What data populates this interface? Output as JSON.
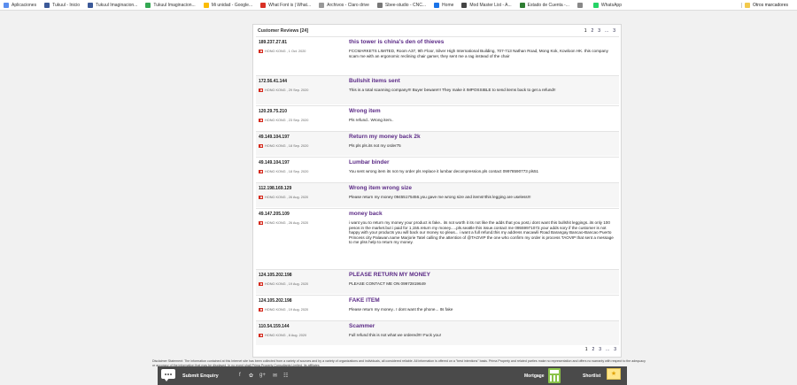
{
  "bookmarks": [
    {
      "label": "Aplicaciones",
      "color": "#5a8dee",
      "icon": "apps-grid-icon"
    },
    {
      "label": "Tukuul - Inicio",
      "color": "#3b5998",
      "icon": "facebook-icon"
    },
    {
      "label": "Tukuul Imaginacion...",
      "color": "#3b5998",
      "icon": "facebook-icon"
    },
    {
      "label": "Tukuul Imaginacion...",
      "color": "#34a853",
      "icon": "maps-pin-icon"
    },
    {
      "label": "Mi unidad - Google...",
      "color": "#fbbc05",
      "icon": "drive-icon"
    },
    {
      "label": "What Font is | What...",
      "color": "#d93025",
      "icon": "whatfont-icon"
    },
    {
      "label": "Archivos - Claro drive",
      "color": "#999999",
      "icon": "cloud-icon"
    },
    {
      "label": "Sbee-studio - CNC...",
      "color": "#777777",
      "icon": "sbee-icon"
    },
    {
      "label": "Home",
      "color": "#1a73e8",
      "icon": "home-icon"
    },
    {
      "label": "Mod Master List - A...",
      "color": "#444444",
      "icon": "mod-icon"
    },
    {
      "label": "Estado de Cuenta -...",
      "color": "#2e7d32",
      "icon": "bank-icon"
    },
    {
      "label": "",
      "color": "#888888",
      "icon": "globe-icon"
    },
    {
      "label": "WhatsApp",
      "color": "#25d366",
      "icon": "whatsapp-icon"
    }
  ],
  "other_bookmarks": "Otros marcadores",
  "reviews_title": "Customer Reviews [24]",
  "pager": {
    "pages": [
      "1",
      "2",
      "3"
    ],
    "ellipsis": "...",
    "last": "3"
  },
  "reviews": [
    {
      "ip": "189.237.27.81",
      "meta": "HONG KONG , 1 Oct. 2020",
      "title": "this tower is china's den of thieves",
      "body": "FCCMARKETS LIMITED, Room A37, 9th Floor, Silver High International Building, 707-713 Nathan Road, Mong Kok, Kowloon HK. this company scam me with an ergonomic reclining chair gamer, they sent me a rag instead of the chair"
    },
    {
      "ip": "172.56.41.144",
      "meta": "HONG KONG , 29 Sep. 2020",
      "title": "Bullshit items sent",
      "body": "This is a total scanning company!!! Buyer beware!!! They make it IMPOSSIBLE to send items back to get a refund!!"
    },
    {
      "ip": "120.29.75.210",
      "meta": "HONG KONG , 23 Sep. 2020",
      "title": "Wrong item",
      "body": "Pls refund.. Wrong item.."
    },
    {
      "ip": "49.149.104.197",
      "meta": "HONG KONG , 18 Sep. 2020",
      "title": "Return my money back 2k",
      "body": "Pls pls pls.its not my order75"
    },
    {
      "ip": "49.149.104.197",
      "meta": "HONG KONG , 18 Sep. 2020",
      "title": "Lumbar binder",
      "body": "You sent wrong item its not my order pls replace it lumbar decompression.pls contact 09978590773 pls51"
    },
    {
      "ip": "112.198.169.129",
      "meta": "HONG KONG , 26 Aug. 2020",
      "title": "Wrong item wrong size",
      "body": "Please return my money 09455175456.you gave me wrong size and items!!this legging are useless!!!"
    },
    {
      "ip": "49.147.205.109",
      "meta": "HONG KONG , 26 Aug. 2020",
      "title": "money back",
      "body": "i want you to return my money your product is fake.. its not worth it its not like the adds that you post,i dont want this bullshit leggings..its only 100 pesos in the market.but i paid for 1,155.return my money.....pls.seattle this issue.contact me 09559971072.your adds sory if the customer is not happy with your products you will back our money so pleas... i want a full refund.this my address macawili Road Barangay Bancao-Bancao Puerto Princess city Palawan.name Marjorie Tatel calling the attention of @TAOVIP the one who confirm my order is process TAOVIP that sent a message to me plss help to return my money."
    },
    {
      "ip": "124.105.202.198",
      "meta": "HONG KONG , 19 Aug. 2020",
      "title": "PLEASE RETURN MY MONEY",
      "body": "PLEASE CONTACT ME ON 09972819649"
    },
    {
      "ip": "124.105.202.198",
      "meta": "HONG KONG , 19 Aug. 2020",
      "title": "FAKE ITEM",
      "body": "Please return my money.. I dont want the phone... Its fake"
    },
    {
      "ip": "110.54.159.144",
      "meta": "HONG KONG , 8 Aug. 2020",
      "title": "Scammer",
      "body": "Full refund this is not what we ordered!!!! Fuck you!"
    }
  ],
  "disclaimer": "Disclaimer Statement: The information contained at this Internet site has been collected from a variety of sources and by a variety of organizations and individuals, all considered reliable. All information is offered on a \"best intentions\" basis. Prima Property and related parties make no representation and offers no warranty with respect to the adequacy or accuracy of the information that may be displayed. In no event shall Prima Property Consultants Limited, its affiliates",
  "footer": {
    "submit": "Submit Enquiry",
    "social": [
      "f",
      "✿",
      "g+",
      "✉",
      "☷"
    ],
    "mortgage": "Mortgage",
    "shortlist": "Shortlist"
  }
}
